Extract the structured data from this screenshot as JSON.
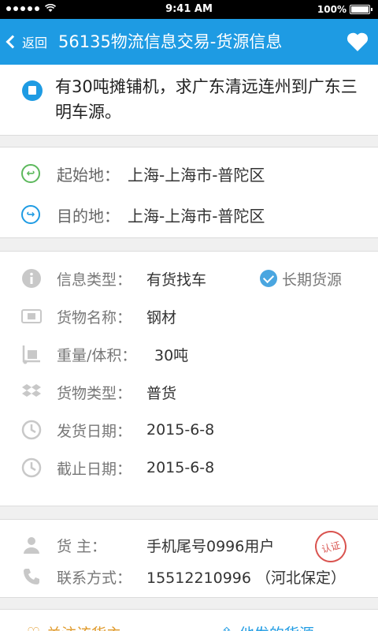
{
  "status_bar": {
    "time": "9:41 AM",
    "battery": "100%"
  },
  "nav": {
    "back_label": "返回",
    "title": "56135物流信息交易-货源信息"
  },
  "headline": {
    "text": "有30吨摊铺机，求广东清远连州到广东三明车源。"
  },
  "route": {
    "origin_label": "起始地：",
    "origin_value": "上海-上海市-普陀区",
    "destination_label": "目的地：",
    "destination_value": "上海-上海市-普陀区"
  },
  "details": {
    "info_type_label": "信息类型：",
    "info_type_value": "有货找车",
    "long_term_label": "长期货源",
    "goods_name_label": "货物名称：",
    "goods_name_value": "钢材",
    "weight_label": "重量/体积：",
    "weight_value": "30吨",
    "goods_type_label": "货物类型：",
    "goods_type_value": "普货",
    "ship_date_label": "发货日期：",
    "ship_date_value": "2015-6-8",
    "deadline_label": "截止日期：",
    "deadline_value": "2015-6-8"
  },
  "contact": {
    "owner_label": "货    主：",
    "owner_value": "手机尾号0996用户",
    "cert_stamp": "认证",
    "phone_label": "联系方式：",
    "phone_value": "15512210996 （河北保定）"
  },
  "bottom": {
    "left_label": "关注该货主",
    "right_label": "他发的货源"
  },
  "colors": {
    "brand": "#1e9be3",
    "origin_icon": "#5cb85c",
    "stamp": "#d9534f"
  }
}
